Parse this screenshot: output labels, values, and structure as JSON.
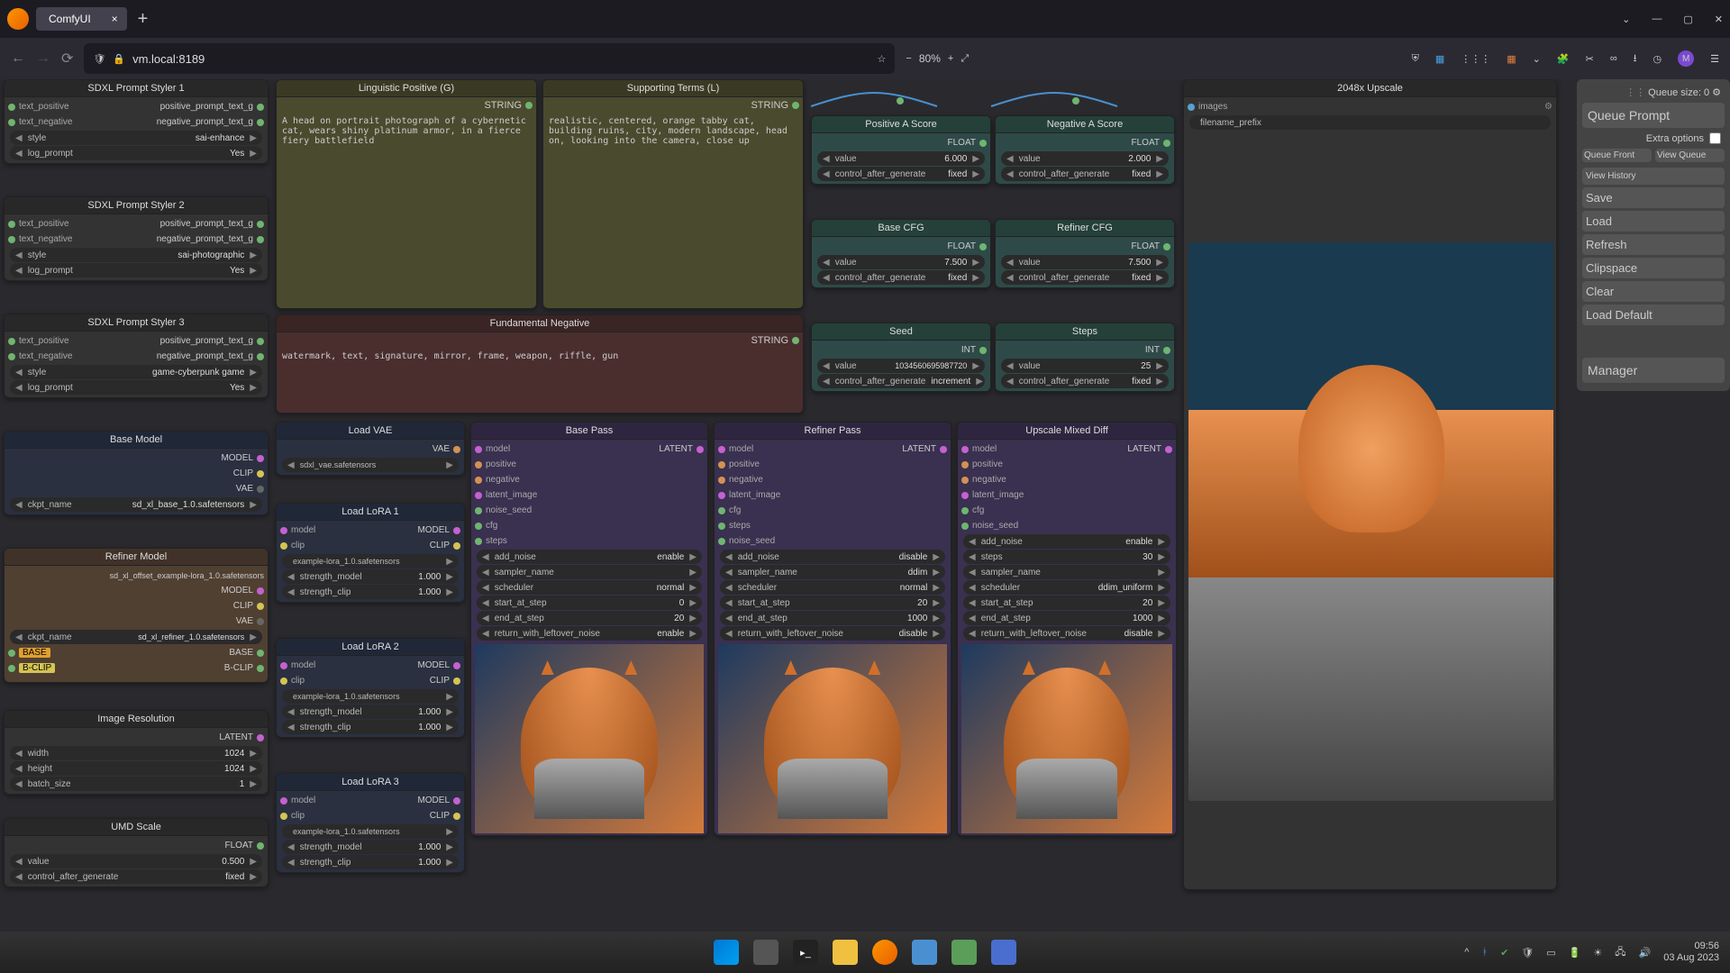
{
  "browser": {
    "tab_title": "ComfyUI",
    "url": "vm.local:8189",
    "zoom": "80%"
  },
  "system": {
    "time": "09:56",
    "date": "03 Aug 2023"
  },
  "side": {
    "queue_size_label": "Queue size:",
    "queue_size": "0",
    "queue_prompt": "Queue Prompt",
    "extra_options": "Extra options",
    "queue_front": "Queue Front",
    "view_queue": "View Queue",
    "view_history": "View History",
    "save": "Save",
    "load": "Load",
    "refresh": "Refresh",
    "clipspace": "Clipspace",
    "clear": "Clear",
    "load_default": "Load Default",
    "manager": "Manager"
  },
  "nodes": {
    "styler1": {
      "title": "SDXL Prompt Styler 1",
      "i1": "text_positive",
      "o1": "positive_prompt_text_g",
      "i2": "text_negative",
      "o2": "negative_prompt_text_g",
      "w_style_n": "style",
      "w_style_v": "sai-enhance",
      "w_log_n": "log_prompt",
      "w_log_v": "Yes"
    },
    "styler2": {
      "title": "SDXL Prompt Styler 2",
      "i1": "text_positive",
      "o1": "positive_prompt_text_g",
      "i2": "text_negative",
      "o2": "negative_prompt_text_g",
      "w_style_n": "style",
      "w_style_v": "sai-photographic",
      "w_log_n": "log_prompt",
      "w_log_v": "Yes"
    },
    "styler3": {
      "title": "SDXL Prompt Styler 3",
      "i1": "text_positive",
      "o1": "positive_prompt_text_g",
      "i2": "text_negative",
      "o2": "negative_prompt_text_g",
      "w_style_n": "style",
      "w_style_v": "game-cyberpunk game",
      "w_log_n": "log_prompt",
      "w_log_v": "Yes"
    },
    "base_model": {
      "title": "Base Model",
      "o1": "MODEL",
      "o2": "CLIP",
      "o3": "VAE",
      "wn": "ckpt_name",
      "wv": "sd_xl_base_1.0.safetensors"
    },
    "refiner_model": {
      "title": "Refiner Model",
      "o1": "MODEL",
      "o2": "CLIP",
      "o3": "VAE",
      "path": "sd_xl_offset_example-lora_1.0.safetensors",
      "wn": "ckpt_name",
      "wv": "sd_xl_refiner_1.0.safetensors",
      "base": "BASE",
      "bclip": "B-CLIP"
    },
    "img_res": {
      "title": "Image Resolution",
      "out": "LATENT",
      "w1n": "width",
      "w1v": "1024",
      "w2n": "height",
      "w2v": "1024",
      "w3n": "batch_size",
      "w3v": "1"
    },
    "umd": {
      "title": "UMD Scale",
      "out": "FLOAT",
      "w1n": "value",
      "w1v": "0.500",
      "w2n": "control_after_generate",
      "w2v": "fixed"
    },
    "ling_pos": {
      "title": "Linguistic Positive (G)",
      "out": "STRING",
      "text": "A head on portrait photograph of a cybernetic cat, wears shiny platinum armor, in a fierce fiery battlefield"
    },
    "support": {
      "title": "Supporting Terms (L)",
      "out": "STRING",
      "text": "realistic, centered, orange tabby cat, building ruins, city, modern landscape, head on, looking into the camera, close up"
    },
    "fund_neg": {
      "title": "Fundamental Negative",
      "out": "STRING",
      "text": "watermark, text, signature, mirror, frame, weapon, riffle, gun"
    },
    "load_vae": {
      "title": "Load VAE",
      "out": "VAE",
      "wn": "sdxl_vae.safetensors",
      "wv": "sdxl_vae.safetensors"
    },
    "lora1": {
      "title": "Load LoRA 1",
      "i1": "model",
      "i2": "clip",
      "o1": "MODEL",
      "o2": "CLIP",
      "path": "example-lora_1.0.safetensors",
      "w1n": "strength_model",
      "w1v": "1.000",
      "w2n": "strength_clip",
      "w2v": "1.000"
    },
    "lora2": {
      "title": "Load LoRA 2",
      "i1": "model",
      "i2": "clip",
      "o1": "MODEL",
      "o2": "CLIP",
      "path": "example-lora_1.0.safetensors",
      "w1n": "strength_model",
      "w1v": "1.000",
      "w2n": "strength_clip",
      "w2v": "1.000"
    },
    "lora3": {
      "title": "Load LoRA 3",
      "i1": "model",
      "i2": "clip",
      "o1": "MODEL",
      "o2": "CLIP",
      "path": "example-lora_1.0.safetensors",
      "w1n": "strength_model",
      "w1v": "1.000",
      "w2n": "strength_clip",
      "w2v": "1.000"
    },
    "pos_a": {
      "title": "Positive A Score",
      "out": "FLOAT",
      "w1n": "value",
      "w1v": "6.000",
      "w2n": "control_after_generate",
      "w2v": "fixed"
    },
    "neg_a": {
      "title": "Negative A Score",
      "out": "FLOAT",
      "w1n": "value",
      "w1v": "2.000",
      "w2n": "control_after_generate",
      "w2v": "fixed"
    },
    "base_cfg": {
      "title": "Base CFG",
      "out": "FLOAT",
      "w1n": "value",
      "w1v": "7.500",
      "w2n": "control_after_generate",
      "w2v": "fixed"
    },
    "ref_cfg": {
      "title": "Refiner CFG",
      "out": "FLOAT",
      "w1n": "value",
      "w1v": "7.500",
      "w2n": "control_after_generate",
      "w2v": "fixed"
    },
    "seed": {
      "title": "Seed",
      "out": "INT",
      "w1n": "value",
      "w1v": "1034560695987720",
      "w2n": "control_after_generate",
      "w2v": "increment"
    },
    "steps": {
      "title": "Steps",
      "out": "INT",
      "w1n": "value",
      "w1v": "25",
      "w2n": "control_after_generate",
      "w2v": "fixed"
    },
    "upscale": {
      "title": "2048x Upscale",
      "i1": "images",
      "w1n": "filename_prefix"
    },
    "base_pass": {
      "title": "Base Pass",
      "out": "LATENT",
      "i": [
        "model",
        "positive",
        "negative",
        "latent_image",
        "noise_seed",
        "cfg",
        "steps"
      ],
      "w": [
        {
          "n": "add_noise",
          "v": "enable"
        },
        {
          "n": "sampler_name",
          "v": ""
        },
        {
          "n": "scheduler",
          "v": "normal"
        },
        {
          "n": "start_at_step",
          "v": "0"
        },
        {
          "n": "end_at_step",
          "v": "20"
        },
        {
          "n": "return_with_leftover_noise",
          "v": "enable"
        }
      ]
    },
    "ref_pass": {
      "title": "Refiner Pass",
      "out": "LATENT",
      "i": [
        "model",
        "positive",
        "negative",
        "latent_image",
        "cfg",
        "steps",
        "noise_seed"
      ],
      "w": [
        {
          "n": "add_noise",
          "v": "disable"
        },
        {
          "n": "sampler_name",
          "v": "ddim"
        },
        {
          "n": "scheduler",
          "v": "normal"
        },
        {
          "n": "start_at_step",
          "v": "20"
        },
        {
          "n": "end_at_step",
          "v": "1000"
        },
        {
          "n": "return_with_leftover_noise",
          "v": "disable"
        }
      ]
    },
    "upmix": {
      "title": "Upscale Mixed Diff",
      "out": "LATENT",
      "i": [
        "model",
        "positive",
        "negative",
        "latent_image",
        "cfg",
        "noise_seed"
      ],
      "w": [
        {
          "n": "add_noise",
          "v": "enable"
        },
        {
          "n": "steps",
          "v": "30"
        },
        {
          "n": "sampler_name",
          "v": ""
        },
        {
          "n": "scheduler",
          "v": "ddim_uniform"
        },
        {
          "n": "start_at_step",
          "v": "20"
        },
        {
          "n": "end_at_step",
          "v": "1000"
        },
        {
          "n": "return_with_leftover_noise",
          "v": "disable"
        }
      ]
    }
  }
}
